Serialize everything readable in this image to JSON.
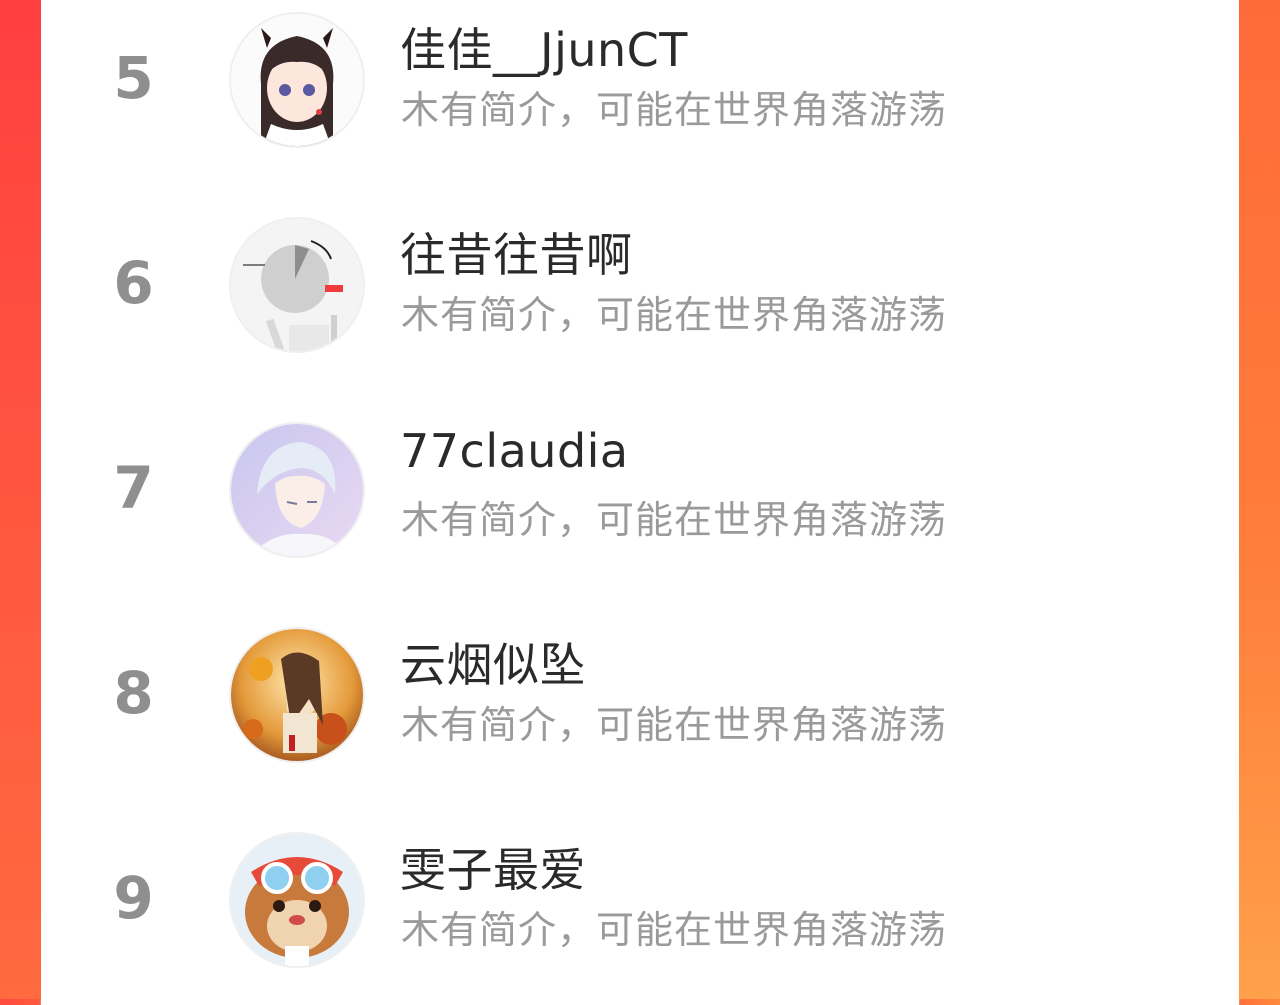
{
  "ranking": {
    "items": [
      {
        "rank": "5",
        "name": "佳佳__JjunCT",
        "bio": "木有简介，可能在世界角落游荡",
        "avatar": "anime-girl-avatar"
      },
      {
        "rank": "6",
        "name": "往昔往昔啊",
        "bio": "木有简介，可能在世界角落游荡",
        "avatar": "gray-abstract-avatar"
      },
      {
        "rank": "7",
        "name": "77claudia",
        "bio": "木有简介，可能在世界角落游荡",
        "avatar": "anime-boy-avatar"
      },
      {
        "rank": "8",
        "name": "云烟似坠",
        "bio": "木有简介，可能在世界角落游荡",
        "avatar": "autumn-illustration-avatar"
      },
      {
        "rank": "9",
        "name": "雯子最爱",
        "bio": "木有简介，可能在世界角落游荡",
        "avatar": "chipmunk-goggles-avatar"
      }
    ]
  },
  "colors": {
    "accent_left": "#ff4a3d",
    "accent_right": "#ff7d3a",
    "rank_text": "#8f8f8f",
    "name_text": "#2a2a2a",
    "bio_text": "#9a9a9a"
  }
}
